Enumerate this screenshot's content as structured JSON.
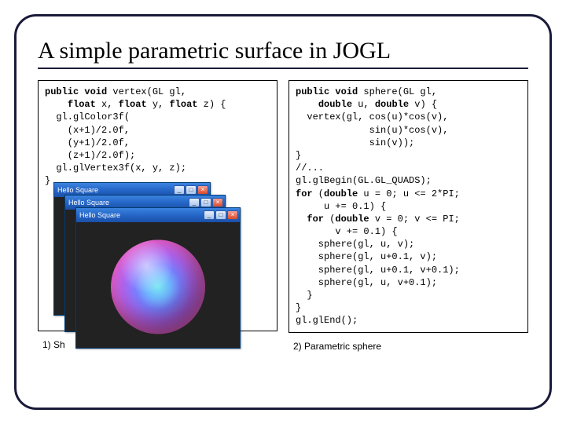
{
  "title": "A simple parametric surface in JOGL",
  "left": {
    "code_html": "<span class=\"kw\">public void</span> vertex(GL gl,\n    <span class=\"kw\">float</span> x, <span class=\"kw\">float</span> y, <span class=\"kw\">float</span> z) {\n  gl.glColor3f(\n    (x+1)/2.0f,\n    (y+1)/2.0f,\n    (z+1)/2.0f);\n  gl.glVertex3f(x, y, z);\n}",
    "caption": "1) Sh"
  },
  "right": {
    "code_html": "<span class=\"kw\">public void</span> sphere(GL gl,\n    <span class=\"kw\">double</span> u, <span class=\"kw\">double</span> v) {\n  vertex(gl, cos(u)*cos(v),\n             sin(u)*cos(v),\n             sin(v));\n}\n//...\ngl.glBegin(GL.GL_QUADS);\n<span class=\"kw\">for</span> (<span class=\"kw\">double</span> u = 0; u <= 2*PI;\n     u += 0.1) {\n  <span class=\"kw\">for</span> (<span class=\"kw\">double</span> v = 0; v <= PI;\n       v += 0.1) {\n    sphere(gl, u, v);\n    sphere(gl, u+0.1, v);\n    sphere(gl, u+0.1, v+0.1);\n    sphere(gl, u, v+0.1);\n  }\n}\ngl.glEnd();",
    "caption": "2) Parametric sphere"
  },
  "window_title": "Hello Square",
  "buttons": {
    "min": "_",
    "max": "□",
    "close": "×"
  }
}
